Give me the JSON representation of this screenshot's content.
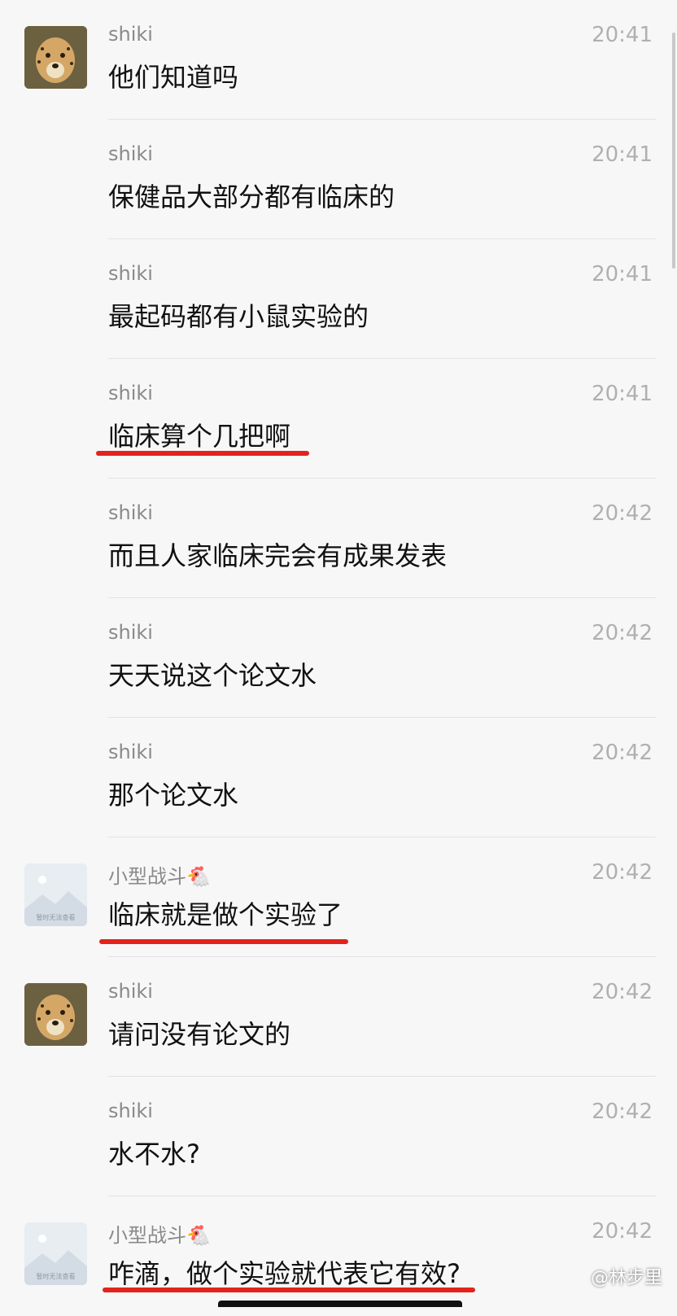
{
  "chat": {
    "messages": [
      {
        "sender": "shiki",
        "time": "20:41",
        "text": "他们知道吗",
        "avatar": "cheetah"
      },
      {
        "sender": "shiki",
        "time": "20:41",
        "text": "保健品大部分都有临床的",
        "avatar": ""
      },
      {
        "sender": "shiki",
        "time": "20:41",
        "text": "最起码都有小鼠实验的",
        "avatar": ""
      },
      {
        "sender": "shiki",
        "time": "20:41",
        "text": "临床算个几把啊",
        "avatar": ""
      },
      {
        "sender": "shiki",
        "time": "20:42",
        "text": "而且人家临床完会有成果发表",
        "avatar": ""
      },
      {
        "sender": "shiki",
        "time": "20:42",
        "text": "天天说这个论文水",
        "avatar": ""
      },
      {
        "sender": "shiki",
        "time": "20:42",
        "text": "那个论文水",
        "avatar": ""
      },
      {
        "sender": "小型战斗🐔",
        "time": "20:42",
        "text": "临床就是做个实验了",
        "avatar": "placeholder"
      },
      {
        "sender": "shiki",
        "time": "20:42",
        "text": "请问没有论文的",
        "avatar": "cheetah"
      },
      {
        "sender": "shiki",
        "time": "20:42",
        "text": "水不水?",
        "avatar": ""
      },
      {
        "sender": "小型战斗🐔",
        "time": "20:42",
        "text": "咋滴，做个实验就代表它有效?",
        "avatar": "placeholder"
      }
    ]
  },
  "placeholder_avatar_text": "暂时无法查看",
  "watermark": "@林步里",
  "colors": {
    "underline": "#e3231b",
    "background": "#f7f7f7"
  }
}
